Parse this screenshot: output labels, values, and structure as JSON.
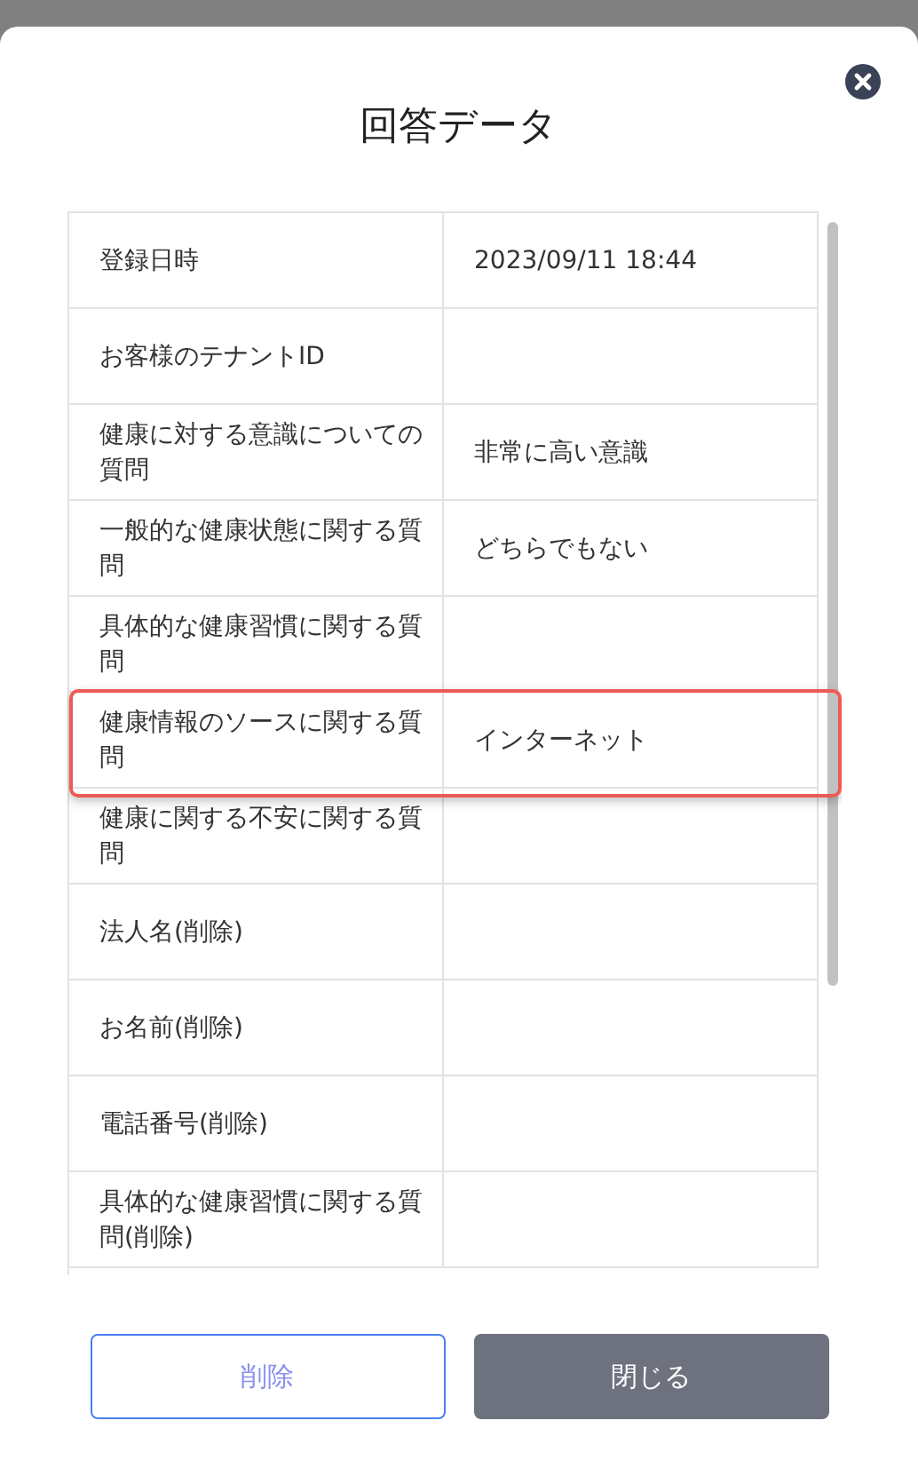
{
  "dialog": {
    "title": "回答データ"
  },
  "rows": [
    {
      "label": "登録日時",
      "value": "2023/09/11 18:44",
      "highlighted": false
    },
    {
      "label": "お客様のテナントID",
      "highlighted": false
    },
    {
      "label": "健康に対する意識についての質問",
      "value": "非常に高い意識",
      "highlighted": false
    },
    {
      "label": "一般的な健康状態に関する質問",
      "value": "どちらでもない",
      "highlighted": false
    },
    {
      "label": "具体的な健康習慣に関する質問",
      "highlighted": false
    },
    {
      "label": "健康情報のソースに関する質問",
      "value": "インターネット",
      "highlighted": true
    },
    {
      "label": "健康に関する不安に関する質問",
      "highlighted": false
    },
    {
      "label": "法人名(削除)",
      "highlighted": false
    },
    {
      "label": "お名前(削除)",
      "highlighted": false
    },
    {
      "label": "電話番号(削除)",
      "highlighted": false
    },
    {
      "label": "具体的な健康習慣に関する質問(削除)",
      "highlighted": false
    }
  ],
  "buttons": [
    {
      "label": "削除",
      "kind": "outline"
    },
    {
      "label": "閉じる",
      "kind": "filled"
    }
  ]
}
